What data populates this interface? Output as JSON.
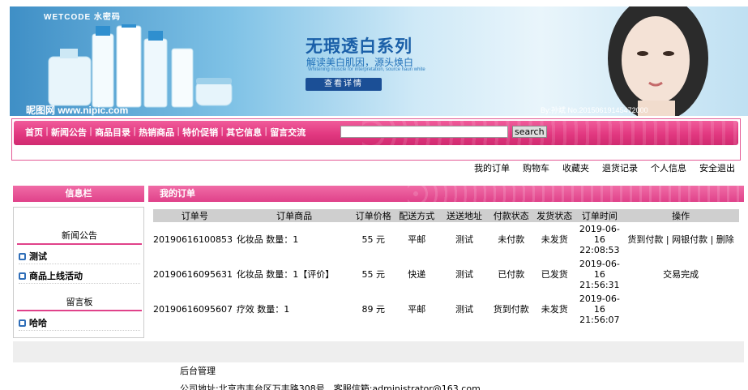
{
  "banner": {
    "brand": "WETCODE 水密码",
    "headline": "无瑕透白系列",
    "subtitle": "解读美白肌因，源头焕白",
    "subtitle_en": "Whitening muscle for interpretation, source haun white",
    "detail_button": "查看详情",
    "watermark": "昵图网 www.nipic.com",
    "serial": "By:孙斌 No.20150619145472000"
  },
  "nav": {
    "items": [
      "首页",
      "新闻公告",
      "商品目录",
      "热销商品",
      "特价促销",
      "其它信息",
      "留言交流"
    ],
    "search_value": "",
    "search_button": "search"
  },
  "user_links": [
    "我的订单",
    "购物车",
    "收藏夹",
    "退货记录",
    "个人信息",
    "安全退出"
  ],
  "sidebar": {
    "title": "信息栏",
    "sections": [
      {
        "title": "新闻公告",
        "items": [
          "测试",
          "商品上线活动"
        ]
      },
      {
        "title": "留言板",
        "items": [
          "哈哈"
        ]
      }
    ]
  },
  "main": {
    "title": "我的订单",
    "columns": [
      "订单号",
      "订单商品",
      "订单价格",
      "配送方式",
      "送送地址",
      "付款状态",
      "发货状态",
      "订单时间",
      "操作"
    ],
    "orders": [
      {
        "id": "20190616100853",
        "product": "化妆品 数量：1",
        "price": "55 元",
        "shipping": "平邮",
        "address": "测试",
        "payment": "未付款",
        "delivery": "未发货",
        "time": "2019-06-16 22:08:53",
        "actions": [
          "货到付款",
          "网银付款",
          "删除"
        ]
      },
      {
        "id": "20190616095631",
        "product": "化妆品 数量：1【评价】",
        "price": "55 元",
        "shipping": "快递",
        "address": "测试",
        "payment": "已付款",
        "delivery": "已发货",
        "time": "2019-06-16 21:56:31",
        "actions": [
          "交易完成"
        ]
      },
      {
        "id": "20190616095607",
        "product": "疗效 数量：1",
        "price": "89 元",
        "shipping": "平邮",
        "address": "测试",
        "payment": "货到付款",
        "delivery": "未发货",
        "time": "2019-06-16 21:56:07",
        "actions": []
      }
    ]
  },
  "footer": {
    "admin_link": "后台管理",
    "info": "公司地址:北京市丰台区万丰路308号　客服信箱:administrator@163.com"
  },
  "colors": {
    "accent": "#e0428a",
    "nav_pink": "#e23880",
    "header_gray": "#cfcfcf"
  }
}
